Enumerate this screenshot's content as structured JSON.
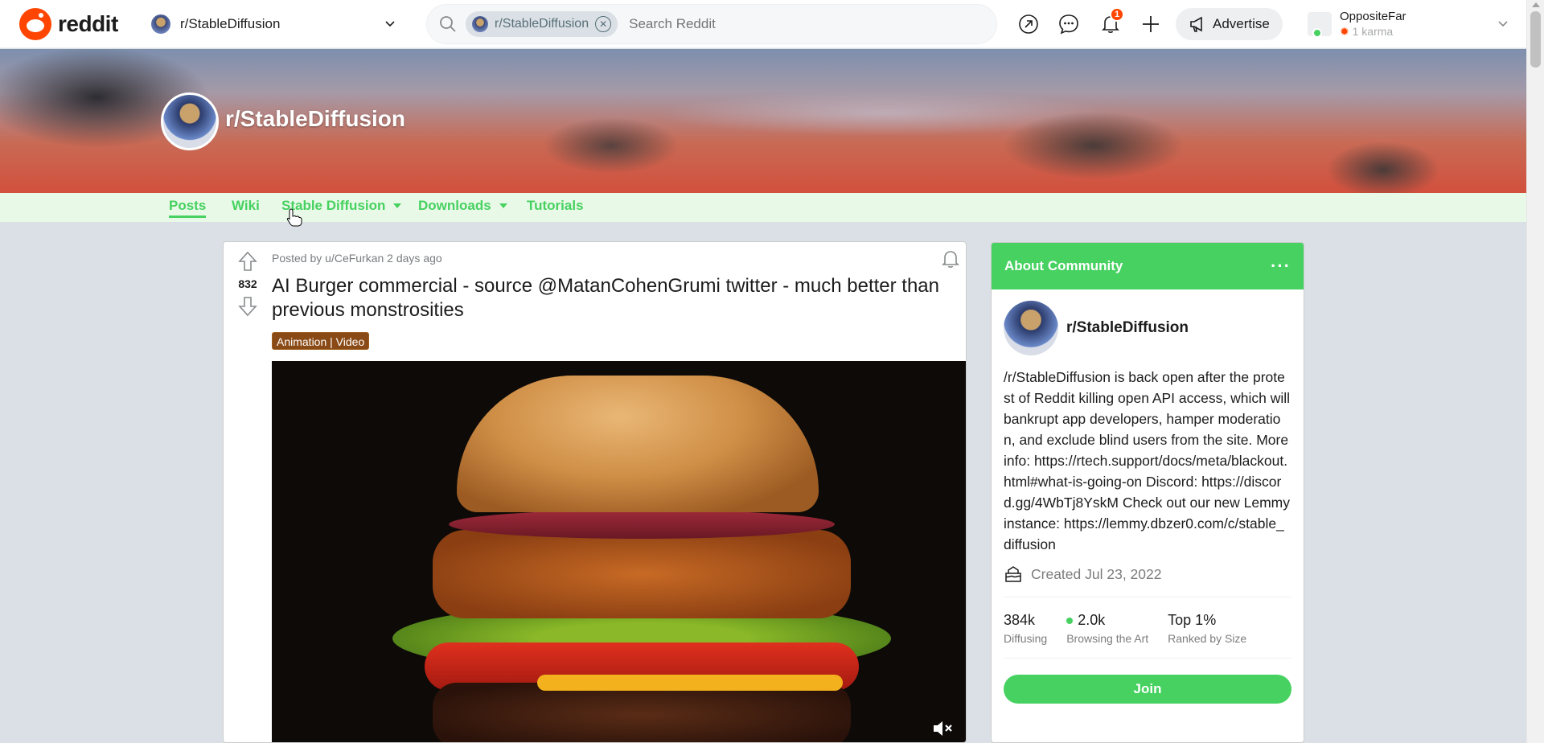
{
  "header": {
    "logo_text": "reddit",
    "community_switch": "r/StableDiffusion",
    "search": {
      "chip": "r/StableDiffusion",
      "placeholder": "Search Reddit"
    },
    "notification_count": "1",
    "advertise_label": "Advertise",
    "user": {
      "name": "OppositeFar",
      "karma": "1 karma"
    },
    "icons": [
      "popular-icon",
      "chat-icon",
      "bell-icon",
      "plus-icon",
      "megaphone-icon"
    ]
  },
  "banner": {
    "title": "r/StableDiffusion"
  },
  "subnav": {
    "items": [
      {
        "label": "Posts",
        "active": true
      },
      {
        "label": "Wiki"
      },
      {
        "label": "Stable Diffusion",
        "dropdown": true
      },
      {
        "label": "Downloads",
        "dropdown": true
      },
      {
        "label": "Tutorials"
      }
    ]
  },
  "post": {
    "votes": "832",
    "posted_by": "Posted by u/CeFurkan 2 days ago",
    "title": "AI Burger commercial - source @MatanCohenGrumi twitter - much better than previous monstrosities",
    "flair": "Animation | Video"
  },
  "about": {
    "heading": "About Community",
    "name": "r/StableDiffusion",
    "description": "/r/StableDiffusion is back open after the protest of Reddit killing open API access, which will bankrupt app developers, hamper moderation, and exclude blind users from the site. More info: https://rtech.support/docs/meta/blackout.html#what-is-going-on Discord: https://discord.gg/4WbTj8YskM Check out our new Lemmy instance: https://lemmy.dbzer0.com/c/stable_diffusion",
    "created": "Created Jul 23, 2022",
    "stats": [
      {
        "value": "384k",
        "label": "Diffusing"
      },
      {
        "value": "2.0k",
        "label": "Browsing the Art",
        "online": true
      },
      {
        "value": "Top 1%",
        "label": "Ranked by Size"
      }
    ],
    "join_label": "Join"
  },
  "colors": {
    "accent": "#46d160",
    "brand": "#ff4500",
    "subnav_bg": "#e9f9e8"
  }
}
